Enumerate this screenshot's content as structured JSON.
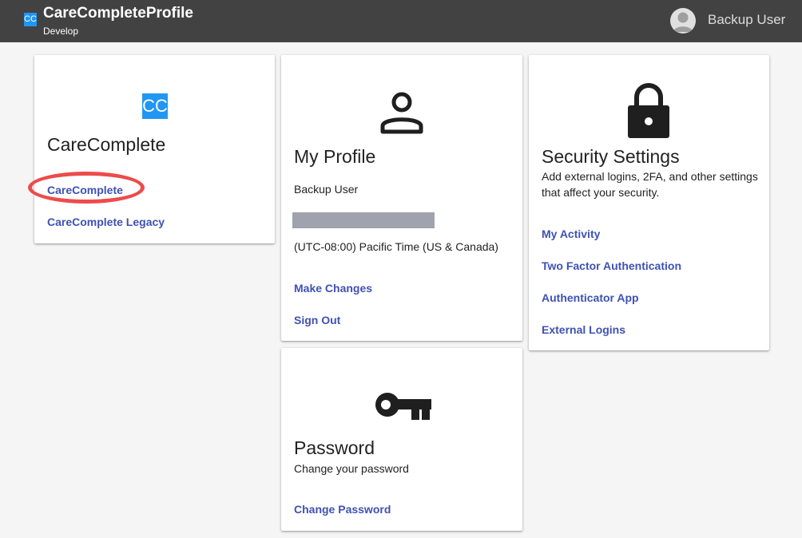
{
  "app": {
    "logo_text": "CC",
    "title": "CareCompleteProfile",
    "environment": "Develop",
    "user_name": "Backup User"
  },
  "cards": {
    "carecomplete": {
      "logo_text": "CC",
      "title": "CareComplete",
      "links": [
        "CareComplete",
        "CareComplete Legacy"
      ]
    },
    "profile": {
      "icon": "person-icon",
      "title": "My Profile",
      "name": "Backup User",
      "timezone": "(UTC-08:00) Pacific Time (US & Canada)",
      "links": [
        "Make Changes",
        "Sign Out"
      ]
    },
    "security": {
      "icon": "lock-icon",
      "title": "Security Settings",
      "description": "Add external logins, 2FA, and other settings that affect your security.",
      "links": [
        "My Activity",
        "Two Factor Authentication",
        "Authenticator App",
        "External Logins"
      ]
    },
    "password": {
      "icon": "key-icon",
      "title": "Password",
      "description": "Change your password",
      "links": [
        "Change Password"
      ]
    }
  },
  "colors": {
    "appbar": "#424242",
    "link": "#3f51b5",
    "logo": "#2196f3",
    "annotation": "#ee4b4b"
  }
}
